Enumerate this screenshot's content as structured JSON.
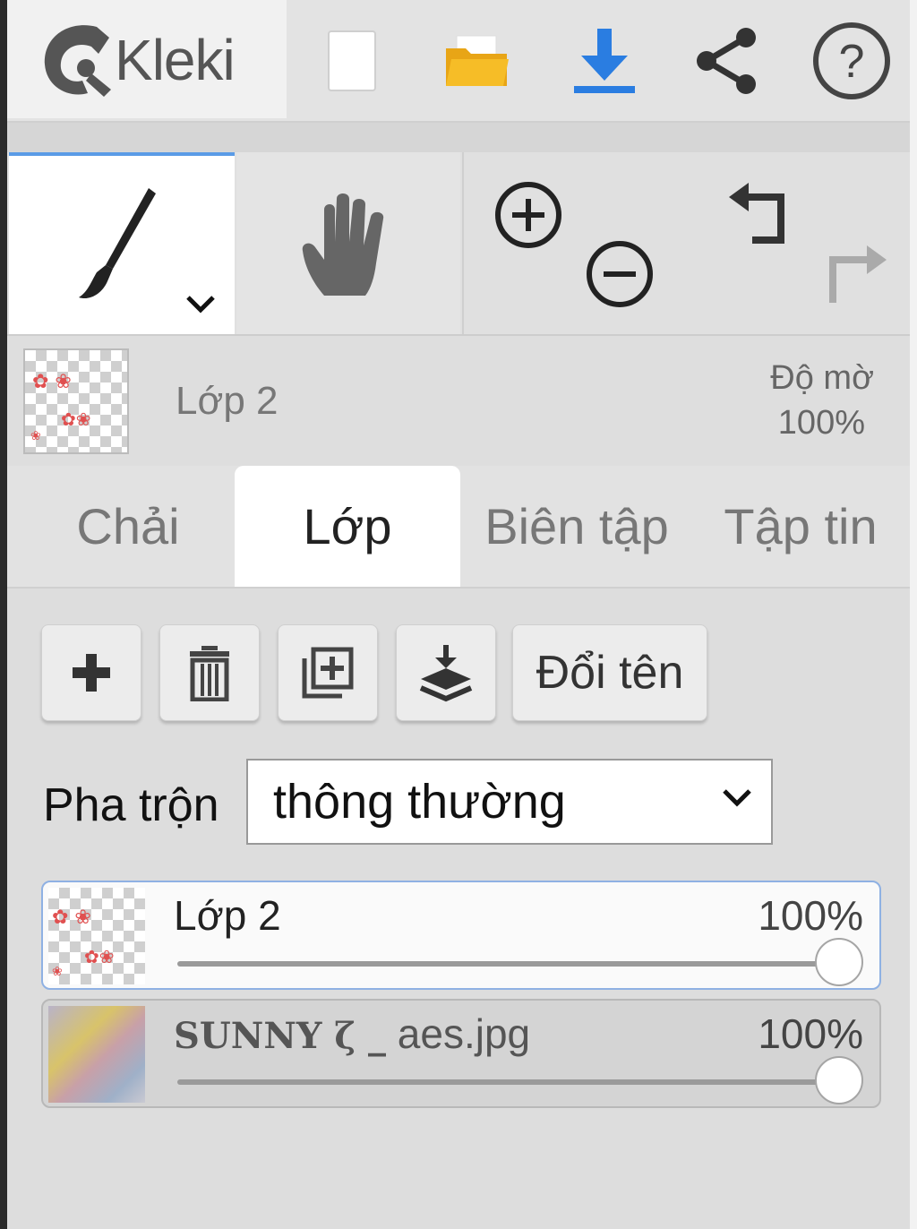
{
  "app": {
    "name": "Kleki"
  },
  "toolbar": {
    "new_label": "new-file",
    "open_label": "open-folder",
    "save_label": "download",
    "share_label": "share",
    "help_label": "help"
  },
  "colors": {
    "accent": "#2a7de1",
    "folder": "#f4b61a",
    "active_tab_border": "#5a9be6"
  },
  "tools": {
    "brush": "brush-icon",
    "hand": "hand-icon",
    "zoom_in": "zoom-in-icon",
    "zoom_out": "zoom-out-icon",
    "undo": "undo-icon",
    "redo": "redo-icon"
  },
  "current_layer": {
    "name": "Lớp 2",
    "opacity_label": "Độ mờ",
    "opacity_value": "100%"
  },
  "tabs": [
    {
      "label": "Chải",
      "active": false
    },
    {
      "label": "Lớp",
      "active": true
    },
    {
      "label": "Biên tập",
      "active": false
    },
    {
      "label": "Tập tin",
      "active": false
    }
  ],
  "layer_actions": {
    "add": "plus-icon",
    "delete": "trash-icon",
    "duplicate": "duplicate-icon",
    "merge_down": "merge-down-icon",
    "rename_label": "Đổi tên"
  },
  "blend": {
    "label": "Pha trộn",
    "value": "thông thường"
  },
  "layers": [
    {
      "name": "Lớp 2",
      "opacity": "100%",
      "opacity_value": 1.0,
      "selected": true
    },
    {
      "name_bold": "SUNNY ζ _",
      "name_rest": " aes.jpg",
      "opacity": "100%",
      "opacity_value": 1.0,
      "selected": false
    }
  ]
}
